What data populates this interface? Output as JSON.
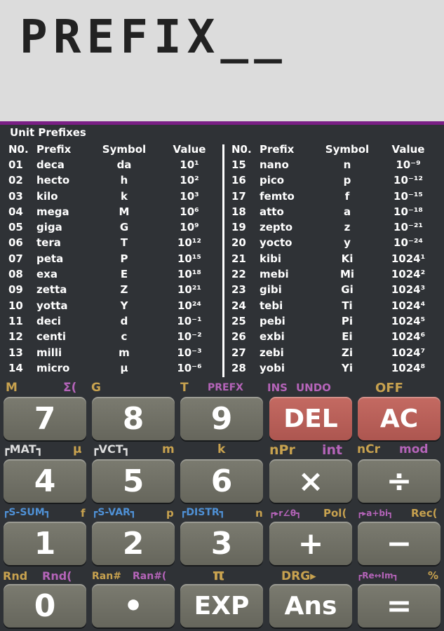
{
  "display": {
    "text": "PREFIX__"
  },
  "panel": {
    "title": "Unit Prefixes",
    "headers": {
      "no": "N0.",
      "prefix": "Prefix",
      "symbol": "Symbol",
      "value": "Value"
    },
    "left": [
      {
        "no": "01",
        "prefix": "deca",
        "symbol": "da",
        "value": "10¹"
      },
      {
        "no": "02",
        "prefix": "hecto",
        "symbol": "h",
        "value": "10²"
      },
      {
        "no": "03",
        "prefix": "kilo",
        "symbol": "k",
        "value": "10³"
      },
      {
        "no": "04",
        "prefix": "mega",
        "symbol": "M",
        "value": "10⁶"
      },
      {
        "no": "05",
        "prefix": "giga",
        "symbol": "G",
        "value": "10⁹"
      },
      {
        "no": "06",
        "prefix": "tera",
        "symbol": "T",
        "value": "10¹²"
      },
      {
        "no": "07",
        "prefix": "peta",
        "symbol": "P",
        "value": "10¹⁵"
      },
      {
        "no": "08",
        "prefix": "exa",
        "symbol": "E",
        "value": "10¹⁸"
      },
      {
        "no": "09",
        "prefix": "zetta",
        "symbol": "Z",
        "value": "10²¹"
      },
      {
        "no": "10",
        "prefix": "yotta",
        "symbol": "Y",
        "value": "10²⁴"
      },
      {
        "no": "11",
        "prefix": "deci",
        "symbol": "d",
        "value": "10⁻¹"
      },
      {
        "no": "12",
        "prefix": "centi",
        "symbol": "c",
        "value": "10⁻²"
      },
      {
        "no": "13",
        "prefix": "milli",
        "symbol": "m",
        "value": "10⁻³"
      },
      {
        "no": "14",
        "prefix": "micro",
        "symbol": "μ",
        "value": "10⁻⁶"
      }
    ],
    "right": [
      {
        "no": "15",
        "prefix": "nano",
        "symbol": "n",
        "value": "10⁻⁹"
      },
      {
        "no": "16",
        "prefix": "pico",
        "symbol": "p",
        "value": "10⁻¹²"
      },
      {
        "no": "17",
        "prefix": "femto",
        "symbol": "f",
        "value": "10⁻¹⁵"
      },
      {
        "no": "18",
        "prefix": "atto",
        "symbol": "a",
        "value": "10⁻¹⁸"
      },
      {
        "no": "19",
        "prefix": "zepto",
        "symbol": "z",
        "value": "10⁻²¹"
      },
      {
        "no": "20",
        "prefix": "yocto",
        "symbol": "y",
        "value": "10⁻²⁴"
      },
      {
        "no": "21",
        "prefix": "kibi",
        "symbol": "Ki",
        "value": "1024¹"
      },
      {
        "no": "22",
        "prefix": "mebi",
        "symbol": "Mi",
        "value": "1024²"
      },
      {
        "no": "23",
        "prefix": "gibi",
        "symbol": "Gi",
        "value": "1024³"
      },
      {
        "no": "24",
        "prefix": "tebi",
        "symbol": "Ti",
        "value": "1024⁴"
      },
      {
        "no": "25",
        "prefix": "pebi",
        "symbol": "Pi",
        "value": "1024⁵"
      },
      {
        "no": "26",
        "prefix": "exbi",
        "symbol": "Ei",
        "value": "1024⁶"
      },
      {
        "no": "27",
        "prefix": "zebi",
        "symbol": "Zi",
        "value": "1024⁷"
      },
      {
        "no": "28",
        "prefix": "yobi",
        "symbol": "Yi",
        "value": "1024⁸"
      }
    ]
  },
  "labels": {
    "row1": {
      "m": "M",
      "sigma": "Σ(",
      "g": "G",
      "t": "T",
      "prefx": "PREFX",
      "ins": "INS",
      "undo": "UNDO",
      "off": "OFF"
    },
    "row2": {
      "mat": "┏MAT┓",
      "mu": "μ",
      "vct": "┏VCT┓",
      "m": "m",
      "k": "k",
      "npr": "nPr",
      "int": "int",
      "ncr": "nCr",
      "mod": "mod"
    },
    "row3": {
      "ssum": "┏S-SUM┓",
      "f": "f",
      "svar": "┏S-VAR┓",
      "p": "p",
      "distr": "┏DISTR┓",
      "n": "n",
      "polar": "┏▸r∠θ┓",
      "pol": "Pol(",
      "rect": "┏▸a+bi┓",
      "rec": "Rec("
    },
    "row4": {
      "rnd": "Rnd",
      "rnd2": "Rnd(",
      "ran": "Ran#",
      "ran2": "Ran#(",
      "pi": "π",
      "drg": "DRG▸",
      "reim": "┏Re↔Im┓",
      "pct": "%"
    }
  },
  "keys": {
    "k7": "7",
    "k8": "8",
    "k9": "9",
    "del": "DEL",
    "ac": "AC",
    "k4": "4",
    "k5": "5",
    "k6": "6",
    "mul": "×",
    "div": "÷",
    "k1": "1",
    "k2": "2",
    "k3": "3",
    "add": "+",
    "sub": "−",
    "k0": "0",
    "dot": "•",
    "exp": "EXP",
    "ans": "Ans",
    "eq": "="
  },
  "colors": {
    "lcd": "#dcdcdc",
    "accent": "#7a1f85",
    "key": "#707066",
    "key_red": "#c46a62",
    "label_yellow": "#c8a24f",
    "label_purple": "#b564b9",
    "label_blue": "#4f91d6"
  }
}
